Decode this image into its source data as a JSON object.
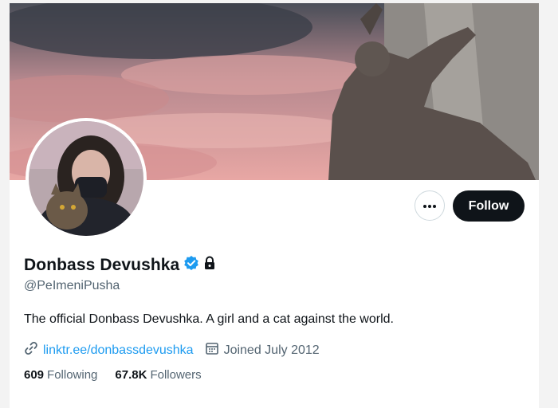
{
  "profile": {
    "display_name": "Donbass Devushka",
    "handle": "@PeImeniPusha",
    "bio": "The official Donbass Devushka. A girl and a cat against the world.",
    "link": "linktr.ee/donbassdevushka",
    "joined": "Joined July 2012",
    "following_count": "609",
    "following_label": "Following",
    "followers_count": "67.8K",
    "followers_label": "Followers",
    "verified": true,
    "protected": true
  },
  "actions": {
    "follow_label": "Follow"
  },
  "icons": {
    "verified": "verified-badge-icon",
    "lock": "lock-icon",
    "more": "more-icon",
    "link": "link-icon",
    "calendar": "calendar-icon"
  },
  "colors": {
    "accent": "#1d9bf0",
    "text": "#0f1419",
    "secondary": "#536471",
    "follow_bg": "#0f1419"
  }
}
